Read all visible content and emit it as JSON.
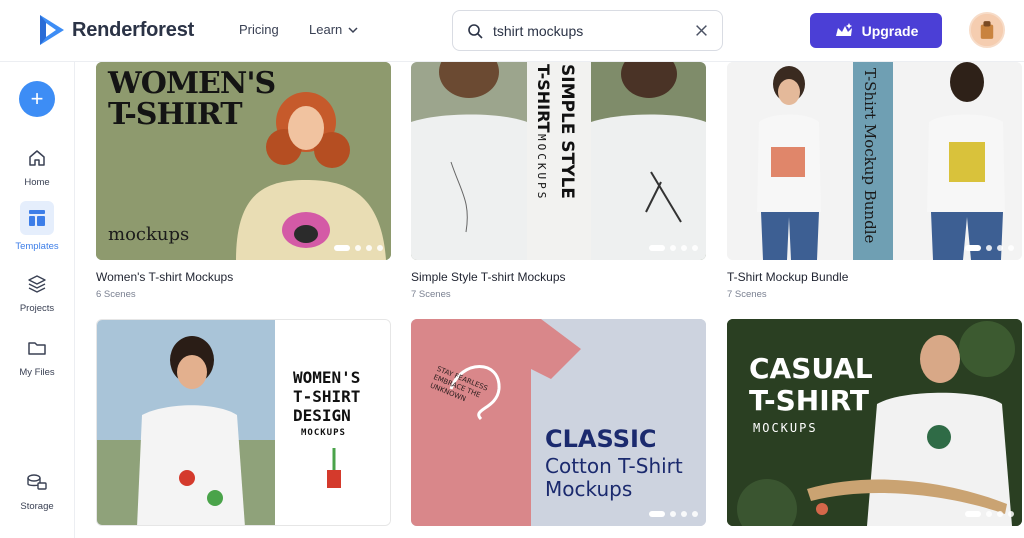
{
  "header": {
    "logo_text": "Renderforest",
    "nav": {
      "pricing": "Pricing",
      "learn": "Learn"
    },
    "search": {
      "value": "tshirt mockups",
      "placeholder": "Search"
    },
    "upgrade_label": "Upgrade"
  },
  "sidebar": {
    "items": [
      {
        "label": "Home",
        "icon": "home-icon"
      },
      {
        "label": "Templates",
        "icon": "templates-icon"
      },
      {
        "label": "Projects",
        "icon": "layers-icon"
      },
      {
        "label": "My Files",
        "icon": "folder-icon"
      },
      {
        "label": "Storage",
        "icon": "storage-icon"
      }
    ]
  },
  "cards": [
    {
      "title": "Women's T-shirt Mockups",
      "scenes": "6 Scenes",
      "art": {
        "heading_1": "WOMEN'S",
        "heading_2": "T-SHIRT",
        "sub": "mockups"
      }
    },
    {
      "title": "Simple Style T-shirt Mockups",
      "scenes": "7 Scenes",
      "art": {
        "v1": "T-SHIRT",
        "v2": "MOCKUPS",
        "v3": "SIMPLE STYLE"
      }
    },
    {
      "title": "T-Shirt Mockup Bundle",
      "scenes": "7 Scenes",
      "art": {
        "v1": "T-Shirt Mockup Bundle"
      }
    },
    {
      "title": "",
      "scenes": "",
      "art": {
        "h1": "WOMEN'S",
        "h2": "T-SHIRT",
        "h3": "DESIGN",
        "h4": "MOCKUPS"
      }
    },
    {
      "title": "",
      "scenes": "",
      "art": {
        "h1": "CLASSIC",
        "h2": "Cotton T-Shirt",
        "h3": "Mockups",
        "shirt_text": "STAY FEARLESS EMBRACE THE UNKNOWN"
      }
    },
    {
      "title": "",
      "scenes": "",
      "art": {
        "h1": "CASUAL",
        "h2": "T-SHIRT",
        "h3": "MOCKUPS"
      }
    }
  ],
  "colors": {
    "accent": "#3d8df5",
    "upgrade": "#4b3fd6",
    "active_nav": "#3d7ee8"
  }
}
